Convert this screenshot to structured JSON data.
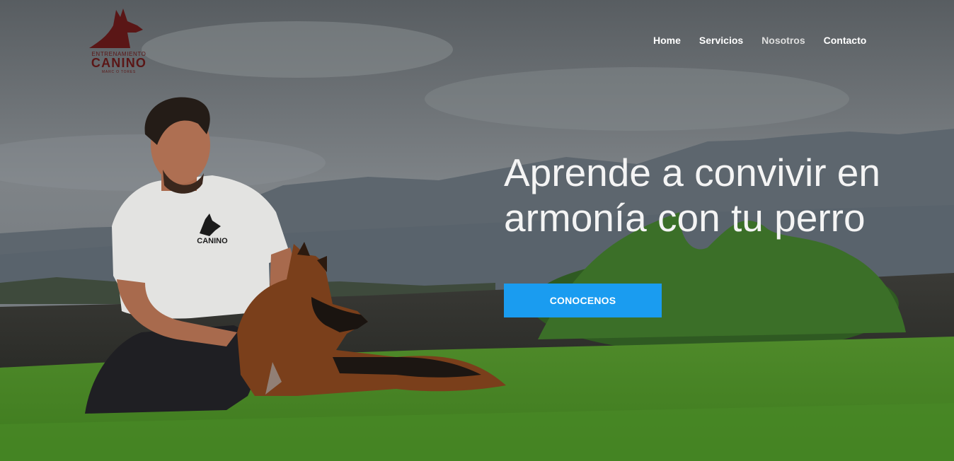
{
  "brand": {
    "line1": "ENTRENAMIENTO",
    "line2": "CANINO",
    "line3": "MARC O TORES",
    "color": "#5a1616"
  },
  "nav": {
    "items": [
      {
        "label": "Home"
      },
      {
        "label": "Servicios"
      },
      {
        "label": "Nosotros"
      },
      {
        "label": "Contacto"
      }
    ]
  },
  "hero": {
    "headline_line1": "Aprende a convivir en",
    "headline_line2": "armonía con tu perro",
    "cta_label": "CONOCENOS",
    "cta_color": "#1a9cf0",
    "shirt_logo_text": "CANINO"
  }
}
